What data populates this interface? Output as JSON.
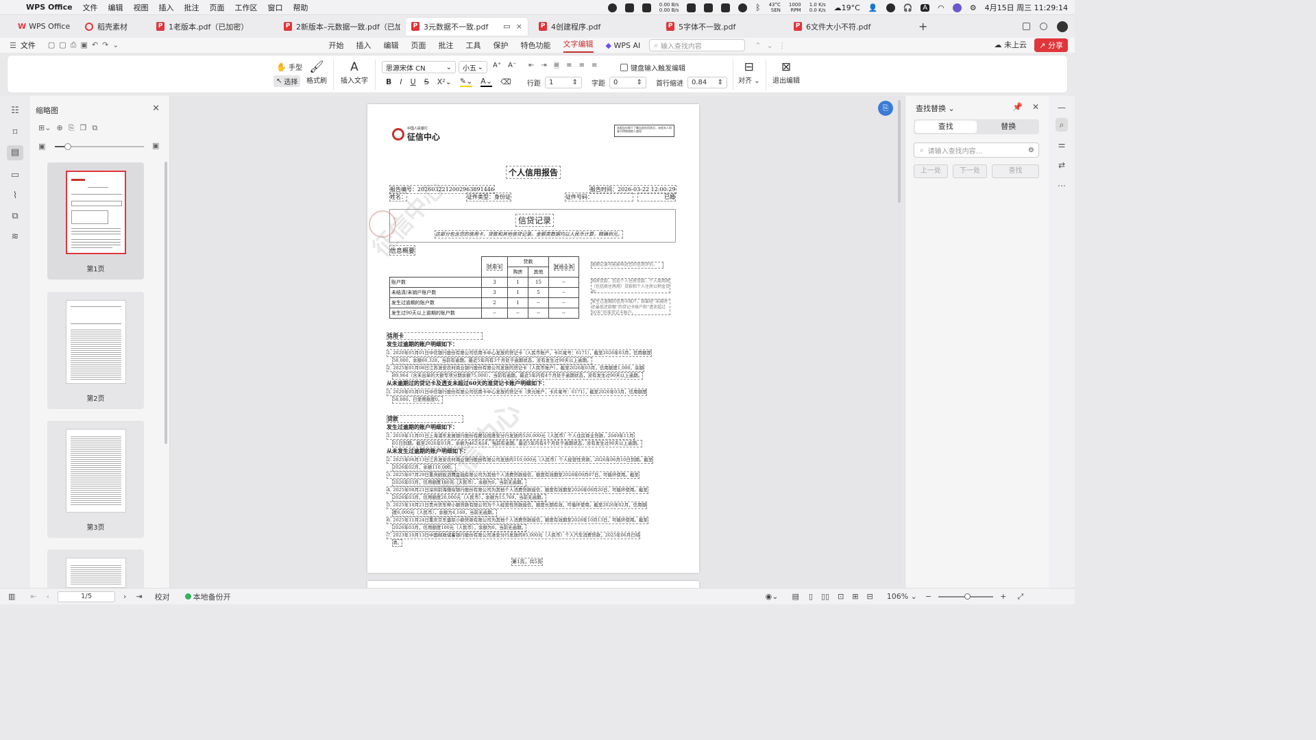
{
  "menubar": {
    "app_name": "WPS Office",
    "items": [
      "文件",
      "编辑",
      "视图",
      "插入",
      "批注",
      "页面",
      "工作区",
      "窗口",
      "帮助"
    ],
    "net_up": "0.00 B/s",
    "net_down": "0.00 B/s",
    "cpu_temp": "43°C",
    "cpu_label": "SEN",
    "fan": "1000",
    "fan_label": "RPM",
    "disk_up": "1.0 K/s",
    "disk_down": "0.0 K/s",
    "weather": "19°C",
    "input_method": "A",
    "datetime": "4月15日 周三 11:29:14"
  },
  "tabs": [
    {
      "label": "WPS Office",
      "type": "wps"
    },
    {
      "label": "稻壳素材",
      "type": "daoke"
    },
    {
      "label": "1老版本.pdf（已加密）",
      "type": "pdf"
    },
    {
      "label": "2新版本–元数据一致.pdf（已加密）",
      "type": "pdf"
    },
    {
      "label": "3元数据不一致.pdf",
      "type": "pdf",
      "active": true
    },
    {
      "label": "4创建程序.pdf",
      "type": "pdf"
    },
    {
      "label": "5字体不一致.pdf",
      "type": "pdf"
    },
    {
      "label": "6文件大小不符.pdf",
      "type": "pdf"
    }
  ],
  "ribbon": {
    "file_label": "文件",
    "tabs": [
      "开始",
      "插入",
      "编辑",
      "页面",
      "批注",
      "工具",
      "保护",
      "特色功能",
      "文字编辑"
    ],
    "active_tab": "文字编辑",
    "wps_ai": "WPS AI",
    "search_placeholder": "输入查找内容",
    "cloud": "未上云",
    "share": "分享"
  },
  "toolbar": {
    "hand": "手型",
    "select": "选择",
    "format_painter": "格式刷",
    "insert_text": "插入文字",
    "font_name": "思源宋体 CN",
    "font_size": "小五",
    "keyboard_trigger": "键盘输入触发编辑",
    "line_spacing_label": "行距",
    "line_spacing": "1",
    "char_spacing_label": "字距",
    "char_spacing": "0",
    "indent_label": "首行缩进",
    "indent": "0.84",
    "align": "对齐",
    "exit_edit": "退出编辑"
  },
  "thumbnails": {
    "title": "缩略图",
    "pages": [
      "第1页",
      "第2页",
      "第3页"
    ]
  },
  "document": {
    "logo_small": "中国人民银行",
    "logo": "征信中心",
    "stamp_note": "本报告仅限于了解自身信用状况，未经本人同意不得转借他人使用",
    "title": "个人信用报告",
    "report_no": "报告编号：2026032212002963891446",
    "report_time": "报告时间：2026-03-22 12:00:29",
    "name_label": "姓名：",
    "id_type": "证件类型：身份证",
    "id_no": "证件号码：",
    "marital": "已婚",
    "section_title": "信贷记录",
    "section_sub": "这部分包含您的信用卡、贷款和其他信贷记录。金额类数据均以人民币计算，精确到元。",
    "overview_title": "信息概要",
    "table_head": [
      "信用卡",
      "贷款",
      "其他业务"
    ],
    "table_subhead": [
      "购房",
      "其他"
    ],
    "table_rows": [
      {
        "label": "账户数",
        "cells": [
          "3",
          "1",
          "15",
          "--"
        ]
      },
      {
        "label": "未结清/未销户账户数",
        "cells": [
          "3",
          "1",
          "5",
          "--"
        ]
      },
      {
        "label": "发生过逾期的账户数",
        "cells": [
          "2",
          "1",
          "--",
          "--"
        ]
      },
      {
        "label": "发生过90天以上逾期的账户数",
        "cells": [
          "--",
          "--",
          "--",
          "--"
        ]
      }
    ],
    "notes": [
      "逾期记录可能影响对您的信用评价。",
      "购房贷款，包括个人住房贷款、个人商用房（包括商住两用）贷款和个人住房公积金贷款。",
      "发生过逾期的信用卡账户，指曾经“未按时还最低还款额”的贷记卡账户和“透支超过60天”的准贷记卡账户。"
    ],
    "credit_title": "信用卡",
    "credit_h1": "发生过逾期的账户明细如下：",
    "credit_lines": [
      "1. 2020年05月01日中信银行股份有限公司信用卡中心发放的贷记卡（人民币账户，卡片尾号：6171），截至2026年03月，信用额度",
      "58,000，余额60,328，当前有逾期。最近5年内有3个月处于逾期状态，没有发生过90天以上逾期。",
      "2. 2025年01月08日江苏淮安农村商业银行股份有限公司发放的贷记卡（人民币账户），截至2026年03月，信用额度1,000，余额",
      "89,964（含未出单的大额专项分期余额75,000），当前有逾期。最近5年内有4个月处于逾期状态，没有发生过90天以上逾期。"
    ],
    "credit_h2": "从未逾期过的贷记卡及透支未超过60天的准贷记卡账户明细如下：",
    "credit_lines2": [
      "3. 2020年05月01日中信银行股份有限公司信用卡中心发放的贷记卡（美元账户，卡片尾号：6171），截至2026年03月，信用额度",
      "58,000，已使用额度0。"
    ],
    "loan_title": "贷款",
    "loan_h1": "发生过逾期的账户明细如下：",
    "loan_lines": [
      "1. 2019年11月01日上海浦东发展银行股份有限公司淮安分行发放的520,000元（人民币）个人住房商业贷款，2049年11月",
      "01日到期。截至2026年03月，余额为462,614，当前有逾期。最近5年内有4个月处于逾期状态，没有发生过90天以上逾期。"
    ],
    "loan_h2": "从未发生过逾期的账户明细如下：",
    "loan_lines2": [
      "2. 2025年06月13日江苏淮安农村商业银行股份有限公司发放的110,000元（人民币）个人经营性贷款，2026年06月10日到期。截至",
      "2026年02月，余额110,000。",
      "3. 2025年07月29日重庆蚂蚁消费金融有限公司为其他个人消费贷款授信，额度有效期至2028年09月07日，可循环使用。截至",
      "2026年03月，信用额度100元（人民币），余额为0，当前无逾期。",
      "4. 2025年08月21日深圳前海微众银行股份有限公司为其他个人消费贷款授信，额度有效期至2026年08月20日，可循环使用。截至",
      "2026年03月，信用额度20,000元（人民币），余额为15,769，当前无逾期。",
      "5. 2025年10月21日贵州货车帮小额贷款有限公司为个人经营性贷款授信，额度长期有效，可循环使用。截至2026年02月，信用额",
      "度6,000元（人民币），余额为4,160，当前无逾期。",
      "6. 2025年11月24日重庆京东盛际小额贷款有限公司为其他个人消费贷款授信，额度有效期至2028年10月13日，可循环使用。截至",
      "2026年03月，信用额度100元（人民币），余额为0，当前无逾期。",
      "7. 2023年10月13日中国邮政储蓄银行股份有限公司淮安分行发放的85,000元（人民币）个人汽车消费贷款，2025年06月已结",
      "清。"
    ],
    "page_footer": "第1页，共5页",
    "watermark": "征信中心"
  },
  "find_panel": {
    "title": "查找替换",
    "tab_find": "查找",
    "tab_replace": "替换",
    "placeholder": "请输入查找内容...",
    "prev": "上一处",
    "next": "下一处",
    "find": "查找"
  },
  "statusbar": {
    "page": "1/5",
    "proofread": "校对",
    "backup": "本地备份开",
    "zoom": "106%"
  }
}
